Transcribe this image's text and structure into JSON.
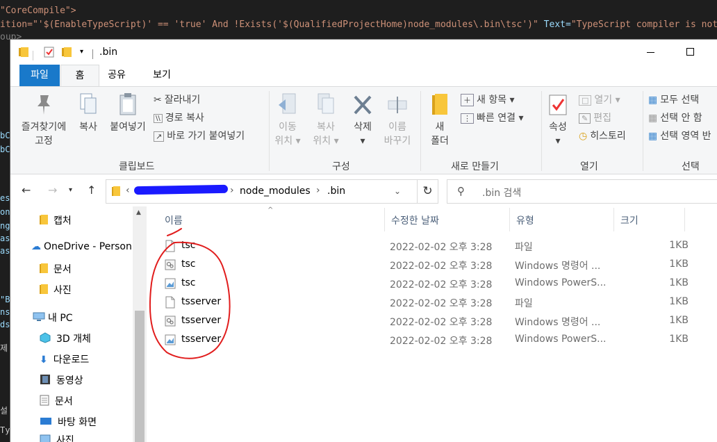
{
  "code_editor": {
    "line1": "\"CoreCompile\">",
    "line2_prefix": "ition=\"'$(EnableTypeScript)' == 'true' And !Exists('$(QualifiedProjectHome)node_modules\\.bin\\tsc')\"",
    "line2_attr": " Text=",
    "line2_value": "\"TypeScript compiler is not insta",
    "line3": "oup>",
    "frag_bo1": "bC",
    "frag_bo2": "bC",
    "frag_1": "es",
    "frag_2": "on",
    "frag_3": "ng",
    "frag_4": "as",
    "frag_5": "as",
    "frag_6": "\"B",
    "frag_7": "ns",
    "frag_8": "ds",
    "frag_9": "제",
    "frag_10": "설",
    "frag_11": "Ty"
  },
  "window": {
    "title": ".bin"
  },
  "ribbon_tabs": [
    "파일",
    "홈",
    "공유",
    "보기"
  ],
  "ribbon": {
    "clipboard": {
      "label": "클립보드",
      "pin": [
        "즐겨찾기에",
        "고정"
      ],
      "copy": "복사",
      "paste": "붙여넣기",
      "cut": "잘라내기",
      "copy_path": "경로 복사",
      "paste_shortcut": "바로 가기 붙여넣기"
    },
    "organize": {
      "label": "구성",
      "move_to": [
        "이동",
        "위치"
      ],
      "copy_to": [
        "복사",
        "위치"
      ],
      "delete": "삭제",
      "rename": [
        "이름",
        "바꾸기"
      ]
    },
    "new": {
      "label": "새로 만들기",
      "new_folder": [
        "새",
        "폴더"
      ],
      "new_item": "새 항목",
      "easy_access": "빠른 연결"
    },
    "open": {
      "label": "열기",
      "properties": "속성",
      "open": "열기",
      "edit": "편집",
      "history": "히스토리"
    },
    "select": {
      "label": "선택",
      "select_all": "모두 선택",
      "select_none": "선택 안 함",
      "invert": "선택 영역 반"
    }
  },
  "address": {
    "crumbs": [
      "node_modules",
      ".bin"
    ],
    "search_placeholder": ".bin 검색"
  },
  "nav_pane": {
    "items": [
      "캡처",
      "OneDrive - Person",
      "문서",
      "사진",
      "내 PC",
      "3D 개체",
      "다운로드",
      "동영상",
      "문서",
      "바탕 화면",
      "사진"
    ]
  },
  "columns": {
    "name": "이름",
    "date": "수정한 날짜",
    "type": "유형",
    "size": "크기"
  },
  "files": [
    {
      "name": "tsc",
      "date": "2022-02-02 오후 3:28",
      "type": "파일",
      "size": "1KB",
      "icon": "file"
    },
    {
      "name": "tsc",
      "date": "2022-02-02 오후 3:28",
      "type": "Windows 명령어 ...",
      "size": "1KB",
      "icon": "cmd"
    },
    {
      "name": "tsc",
      "date": "2022-02-02 오후 3:28",
      "type": "Windows PowerS...",
      "size": "1KB",
      "icon": "ps"
    },
    {
      "name": "tsserver",
      "date": "2022-02-02 오후 3:28",
      "type": "파일",
      "size": "1KB",
      "icon": "file"
    },
    {
      "name": "tsserver",
      "date": "2022-02-02 오후 3:28",
      "type": "Windows 명령어 ...",
      "size": "1KB",
      "icon": "cmd"
    },
    {
      "name": "tsserver",
      "date": "2022-02-02 오후 3:28",
      "type": "Windows PowerS...",
      "size": "1KB",
      "icon": "ps"
    }
  ],
  "colors": {
    "file_tab": "#1979ca",
    "folder": "#f8c63b",
    "annotation": "#e11d1d",
    "redaction": "#1a1aff"
  }
}
